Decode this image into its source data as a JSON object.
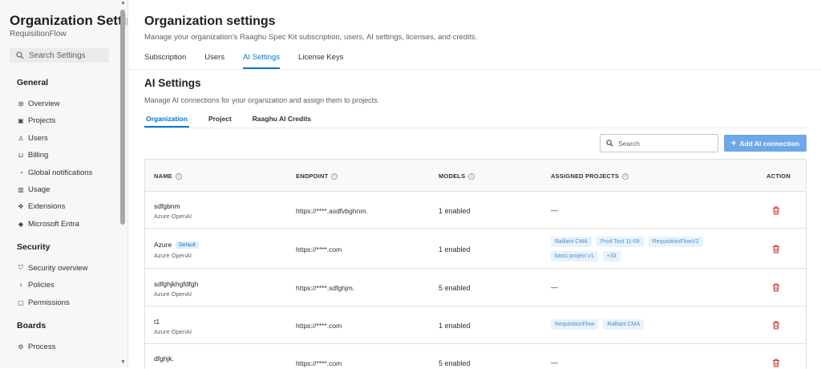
{
  "sidebar": {
    "org_title": "Organization Settin...",
    "org_subtitle": "RequisitionFlow",
    "search_placeholder": "Search Settings",
    "groups": [
      {
        "title": "General",
        "items": [
          {
            "label": "Overview",
            "icon": "grid-icon"
          },
          {
            "label": "Projects",
            "icon": "projects-icon"
          },
          {
            "label": "Users",
            "icon": "users-icon"
          },
          {
            "label": "Billing",
            "icon": "cart-icon"
          },
          {
            "label": "Global notifications",
            "icon": "bell-icon"
          },
          {
            "label": "Usage",
            "icon": "usage-icon"
          },
          {
            "label": "Extensions",
            "icon": "puzzle-icon"
          },
          {
            "label": "Microsoft Entra",
            "icon": "diamond-icon"
          }
        ]
      },
      {
        "title": "Security",
        "items": [
          {
            "label": "Security overview",
            "icon": "shield-icon"
          },
          {
            "label": "Policies",
            "icon": "lightbulb-icon"
          },
          {
            "label": "Permissions",
            "icon": "lock-icon"
          }
        ]
      },
      {
        "title": "Boards",
        "items": [
          {
            "label": "Process",
            "icon": "process-icon"
          }
        ]
      }
    ]
  },
  "header": {
    "title": "Organization settings",
    "description": "Manage your organization's Raaghu Spec Kit subscription, users, AI settings, licenses, and credits.",
    "tabs": [
      {
        "label": "Subscription",
        "active": false
      },
      {
        "label": "Users",
        "active": false
      },
      {
        "label": "AI Settings",
        "active": true
      },
      {
        "label": "License Keys",
        "active": false
      }
    ]
  },
  "ai_settings": {
    "title": "AI Settings",
    "description": "Manage AI connections for your organization and assign them to projects.",
    "subtabs": [
      {
        "label": "Organization",
        "active": true
      },
      {
        "label": "Project",
        "active": false
      },
      {
        "label": "Raaghu AI Credits",
        "active": false
      }
    ],
    "search_placeholder": "Search",
    "add_button": "Add AI connection",
    "columns": {
      "name": "NAME",
      "endpoint": "ENDPOINT",
      "models": "MODELS",
      "assigned_projects": "ASSIGNED PROJECTS",
      "action": "ACTION"
    },
    "rows": [
      {
        "name": "sdfgbnm",
        "provider": "Azure OpenAI",
        "badge": "",
        "endpoint": "https://****.asdfvbghnm.",
        "models": "1 enabled",
        "projects": [],
        "empty": "—"
      },
      {
        "name": "Azure",
        "provider": "Azure OpenAI",
        "badge": "Default",
        "endpoint": "https://****.com",
        "models": "1 enabled",
        "projects": [
          "Ralliant CMA",
          "Prod Test 11-09",
          "RequisitionFlowV2",
          "basic project v1",
          "+33"
        ],
        "empty": ""
      },
      {
        "name": "sdfghjkhgfdfgh",
        "provider": "Azure OpenAI",
        "badge": "",
        "endpoint": "https://****.sdfghjm.",
        "models": "5 enabled",
        "projects": [],
        "empty": "—"
      },
      {
        "name": "t1",
        "provider": "Azure OpenAI",
        "badge": "",
        "endpoint": "https://****.com",
        "models": "1 enabled",
        "projects": [
          "RequisitionFlow",
          "Ralliant CMA"
        ],
        "empty": ""
      },
      {
        "name": "dfghjk.",
        "provider": "",
        "badge": "",
        "endpoint": "https://****.com",
        "models": "5 enabled",
        "projects": [],
        "empty": "—"
      }
    ],
    "colors": {
      "accent": "#0078d4",
      "button": "#6ca9e6",
      "delete": "#d13438",
      "tag_bg": "#e8f2fb"
    }
  }
}
